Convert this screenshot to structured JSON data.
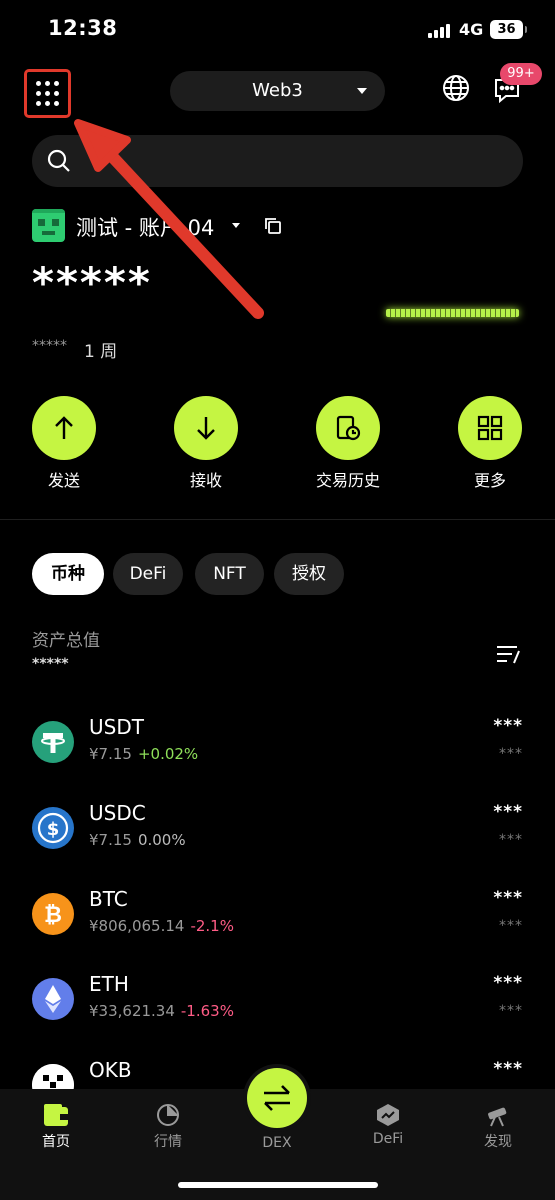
{
  "status_bar": {
    "time": "12:38",
    "network": "4G",
    "battery": "36"
  },
  "header": {
    "network_switch": "Web3",
    "notification_badge": "99+"
  },
  "account": {
    "name": "测试 - 账户 04",
    "balance": "*****",
    "change_amount": "*****",
    "change_period": "1 周"
  },
  "actions": [
    {
      "label": "发送",
      "icon": "arrow-up-icon"
    },
    {
      "label": "接收",
      "icon": "arrow-down-icon"
    },
    {
      "label": "交易历史",
      "icon": "history-icon"
    },
    {
      "label": "更多",
      "icon": "grid-icon"
    }
  ],
  "tabs": [
    {
      "label": "币种"
    },
    {
      "label": "DeFi"
    },
    {
      "label": "NFT"
    },
    {
      "label": "授权"
    }
  ],
  "assets": {
    "total_label": "资产总值",
    "total_value": "*****",
    "items": [
      {
        "symbol": "USDT",
        "price": "¥7.15",
        "change": "+0.02%",
        "amount": "***",
        "value": "***"
      },
      {
        "symbol": "USDC",
        "price": "¥7.15",
        "change": "0.00%",
        "amount": "***",
        "value": "***"
      },
      {
        "symbol": "BTC",
        "price": "¥806,065.14",
        "change": "-2.1%",
        "amount": "***",
        "value": "***"
      },
      {
        "symbol": "ETH",
        "price": "¥33,621.34",
        "change": "-1.63%",
        "amount": "***",
        "value": "***"
      },
      {
        "symbol": "OKB",
        "price": "",
        "change": "",
        "amount": "***",
        "value": ""
      }
    ]
  },
  "bottom_nav": [
    {
      "label": "首页"
    },
    {
      "label": "行情"
    },
    {
      "label": "DEX"
    },
    {
      "label": "DeFi"
    },
    {
      "label": "发现"
    }
  ],
  "colors": {
    "accent": "#c5f542",
    "positive": "#8fe05a",
    "negative": "#ff5c86",
    "highlight": "#e0392b"
  }
}
